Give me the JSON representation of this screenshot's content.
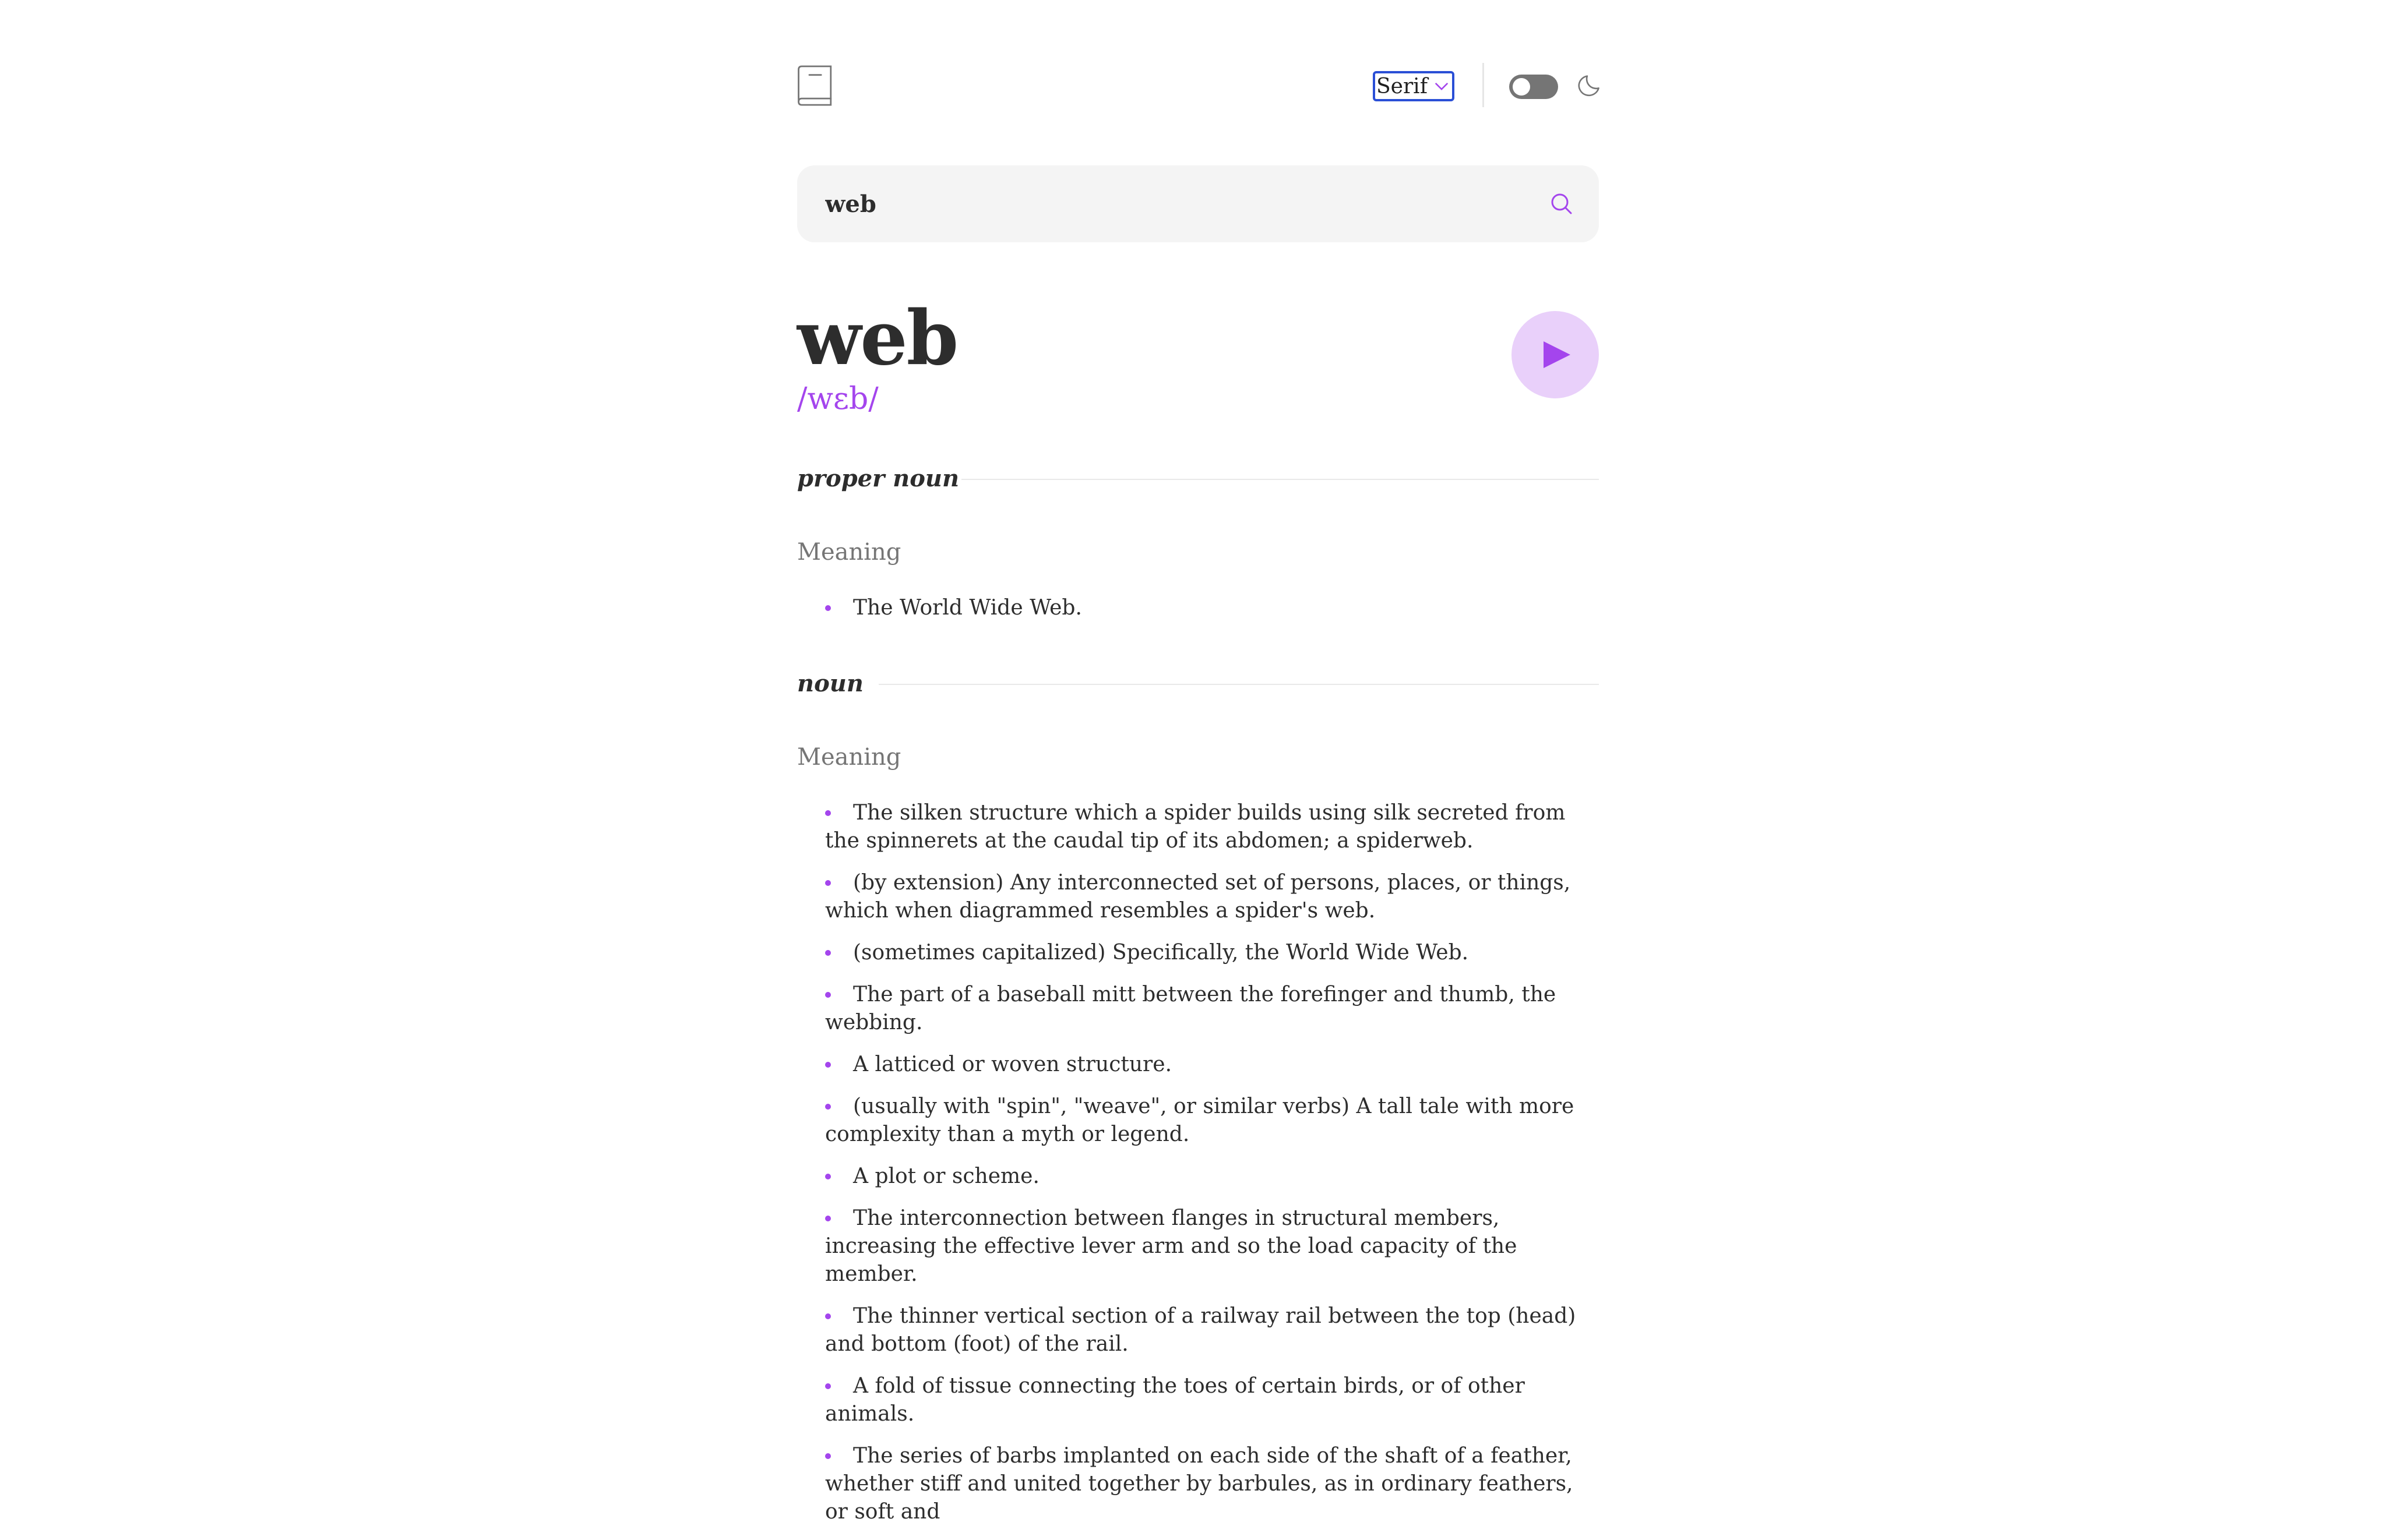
{
  "header": {
    "font_selector": {
      "value": "Serif"
    },
    "theme_toggle": {
      "state": "off"
    },
    "icons": [
      "book-icon",
      "chevron-down-icon",
      "moon-icon"
    ]
  },
  "search": {
    "value": "web",
    "icon": "search-icon"
  },
  "entry": {
    "word": "web",
    "phonetic": "/wɛb/",
    "play_icon": "play-icon"
  },
  "meanings": [
    {
      "part_of_speech": "proper noun",
      "label": "Meaning",
      "definitions": [
        "The World Wide Web."
      ]
    },
    {
      "part_of_speech": "noun",
      "label": "Meaning",
      "definitions": [
        "The silken structure which a spider builds using silk secreted from the spinnerets at the caudal tip of its abdomen; a spiderweb.",
        "(by extension) Any interconnected set of persons, places, or things, which when diagrammed resembles a spider's web.",
        "(sometimes capitalized) Specifically, the World Wide Web.",
        "The part of a baseball mitt between the forefinger and thumb, the webbing.",
        "A latticed or woven structure.",
        "(usually with \"spin\", \"weave\", or similar verbs) A tall tale with more complexity than a myth or legend.",
        "A plot or scheme.",
        "The interconnection between flanges in structural members, increasing the effective lever arm and so the load capacity of the member.",
        "The thinner vertical section of a railway rail between the top (head) and bottom (foot) of the rail.",
        "A fold of tissue connecting the toes of certain birds, or of other animals.",
        "The series of barbs implanted on each side of the shaft of a feather, whether stiff and united together by barbules, as in ordinary feathers, or soft and"
      ]
    }
  ],
  "colors": {
    "accent": "#a445ed",
    "play_bg": "#e9d0fa",
    "search_bg": "#f4f4f4",
    "focus_outline": "#2a4fd6",
    "text": "#2d2d2d",
    "muted": "#757575"
  }
}
